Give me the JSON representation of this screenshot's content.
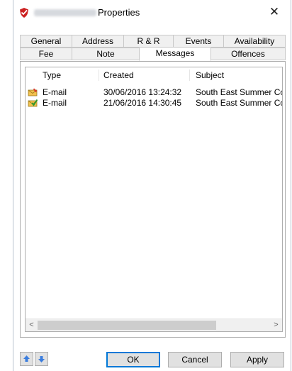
{
  "window": {
    "title": "Properties",
    "close_glyph": "✕"
  },
  "tabs": {
    "row1": [
      {
        "label": "General"
      },
      {
        "label": "Address"
      },
      {
        "label": "R & R"
      },
      {
        "label": "Events"
      },
      {
        "label": "Availability"
      }
    ],
    "row2": [
      {
        "label": "Fee"
      },
      {
        "label": "Note"
      },
      {
        "label": "Messages",
        "active": true
      },
      {
        "label": "Offences"
      }
    ]
  },
  "messages": {
    "columns": [
      "Type",
      "Created",
      "Subject"
    ],
    "rows": [
      {
        "icon": "envelope-open-icon",
        "type": "E-mail",
        "created": "30/06/2016 13:24:32",
        "subject": "South East Summer Cou"
      },
      {
        "icon": "envelope-check-icon",
        "type": "E-mail",
        "created": "21/06/2016 14:30:45",
        "subject": "South East Summer Cou"
      }
    ]
  },
  "scrollbar": {
    "left_glyph": "<",
    "right_glyph": ">"
  },
  "buttons": {
    "ok": "OK",
    "cancel": "Cancel",
    "apply": "Apply"
  },
  "icons": {
    "up": "arrow-up-icon",
    "down": "arrow-down-icon",
    "app": "shield-icon"
  },
  "colors": {
    "accent": "#0078d7",
    "nav_arrow": "#3b7ddd",
    "shield_red": "#cc2222"
  }
}
